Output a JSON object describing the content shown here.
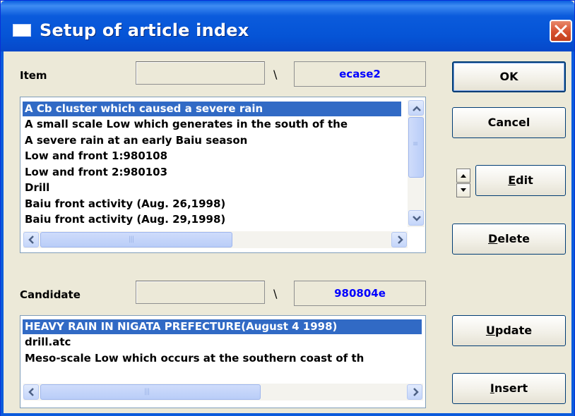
{
  "window": {
    "title": "Setup of article index"
  },
  "item": {
    "label": "Item",
    "path_value": "",
    "separator": "\\",
    "value": "ecase2",
    "list": [
      "A Cb cluster which caused a severe rain",
      "A small scale Low which generates in the south of the",
      "A severe rain at an early Baiu season",
      "Low and front 1:980108",
      "Low and front 2:980103",
      "Drill",
      "Baiu front activity (Aug. 26,1998)",
      "Baiu front activity (Aug. 29,1998)"
    ],
    "selected_index": 0
  },
  "candidate": {
    "label": "Candidate",
    "path_value": "",
    "separator": "\\",
    "value": "980804e",
    "list": [
      "HEAVY RAIN IN NIGATA PREFECTURE(August 4 1998)",
      "drill.atc",
      "Meso-scale Low which occurs at the southern coast of th"
    ],
    "selected_index": 0
  },
  "buttons": {
    "ok": "OK",
    "cancel": "Cancel",
    "edit": "Edit",
    "delete": "Delete",
    "update": "Update",
    "insert": "Insert"
  },
  "icons": {
    "title": "window-icon",
    "close": "close-icon",
    "spin_up": "chevron-up-icon",
    "spin_down": "chevron-down-icon"
  },
  "colors": {
    "titlebar": "#0554d6",
    "selection": "#316ac5",
    "value_text": "#0000ff",
    "dialog_bg": "#ece9d8"
  }
}
